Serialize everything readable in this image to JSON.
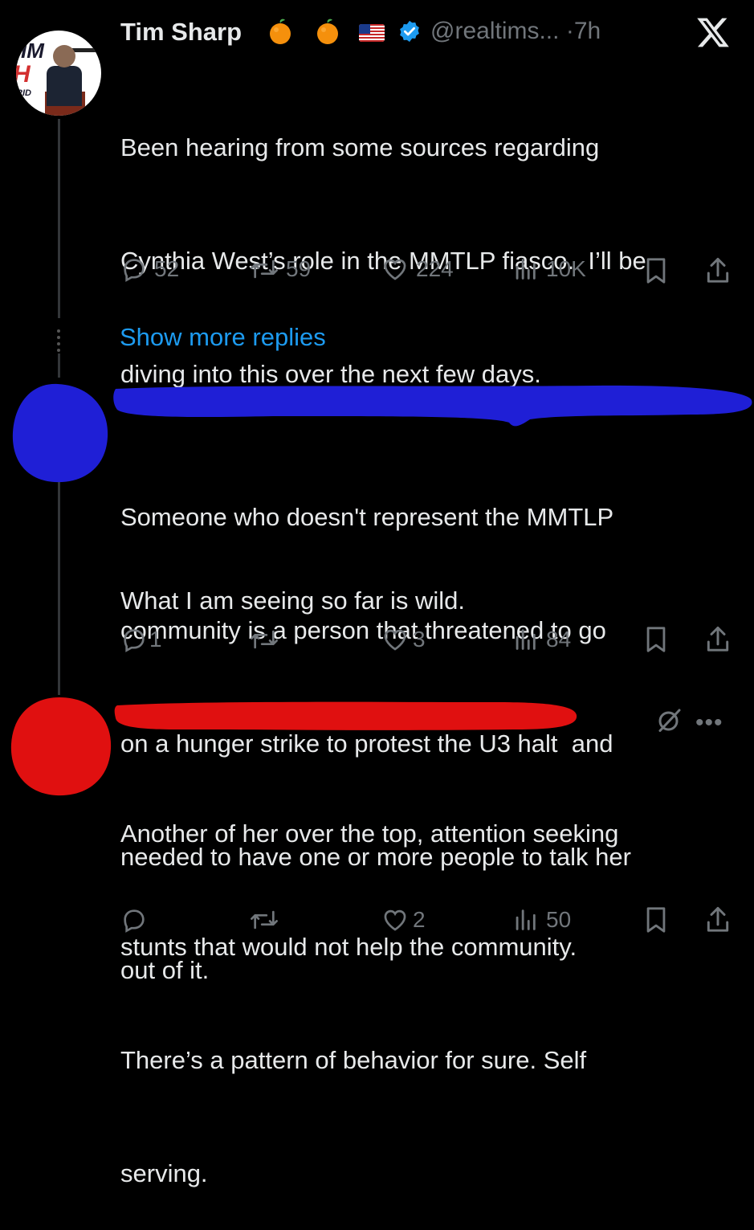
{
  "tweet": {
    "author_name": "Tim Sharp",
    "handle": "@realtims...",
    "time": "7h",
    "time_separator": "·",
    "text_lines": [
      "Been hearing from some sources regarding",
      "Cynthia West’s role in the MMTLP fiasco.  I’ll be",
      "diving into this over the next few days.",
      "",
      "What I am seeing so far is wild."
    ],
    "avatar_text": [
      "IM",
      "H",
      "RID"
    ],
    "stats": {
      "replies": "52",
      "reposts": "59",
      "likes": "224",
      "views": "10K"
    }
  },
  "show_more_replies": "Show more replies",
  "reply1": {
    "text_lines": [
      "Someone who doesn't represent the MMTLP",
      "community is a person that threatened to go",
      "on a hunger strike to protest the U3 halt  and",
      "needed to have one or more people to talk her",
      "out of it."
    ],
    "stats": {
      "replies": "1",
      "reposts": "",
      "likes": "3",
      "views": "84"
    },
    "redaction_color": "#1f1fd6"
  },
  "reply2": {
    "text_lines": [
      "Another of her over the top, attention seeking",
      "stunts that would not help the community.",
      "There’s a pattern of behavior for sure. Self",
      "serving."
    ],
    "stats": {
      "replies": "",
      "reposts": "",
      "likes": "2",
      "views": "50"
    },
    "redaction_color": "#e01010",
    "more_label": "•••"
  },
  "colors": {
    "background": "#000000",
    "text": "#e7e9ea",
    "muted": "#71767b",
    "link": "#1d9bf0",
    "verified": "#1d9bf0"
  },
  "icons": [
    "reply-icon",
    "repost-icon",
    "like-icon",
    "views-icon",
    "bookmark-icon",
    "share-icon",
    "x-logo-icon",
    "verified-icon",
    "orange-emoji-icon",
    "us-flag-icon",
    "grok-icon",
    "more-icon"
  ]
}
